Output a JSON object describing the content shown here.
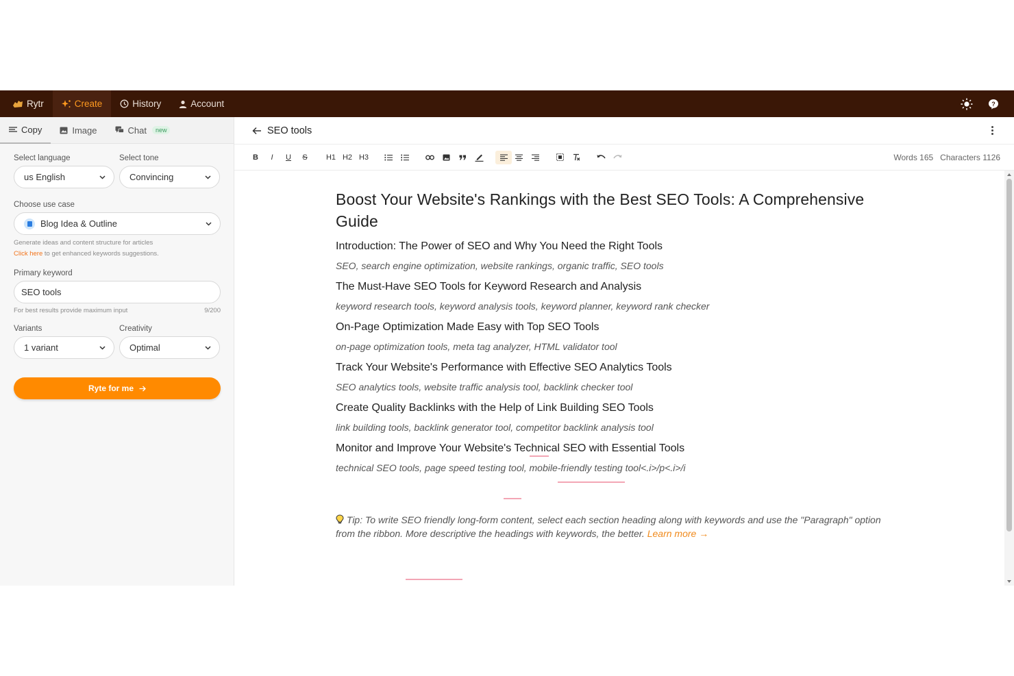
{
  "nav": {
    "logo": "Rytr",
    "items": [
      {
        "label": "Create",
        "icon": "sparkle-icon",
        "active": true
      },
      {
        "label": "History",
        "icon": "clock-icon"
      },
      {
        "label": "Account",
        "icon": "user-icon"
      }
    ],
    "right_icons": [
      "sun-icon",
      "help-icon"
    ]
  },
  "sidebar": {
    "tabs": [
      {
        "label": "Copy",
        "icon": "lines-icon",
        "active": true
      },
      {
        "label": "Image",
        "icon": "image-icon"
      },
      {
        "label": "Chat",
        "icon": "chat-icon",
        "badge": "new"
      }
    ],
    "language": {
      "label": "Select language",
      "value": "us English"
    },
    "tone": {
      "label": "Select tone",
      "value": "Convincing"
    },
    "use_case": {
      "label": "Choose use case",
      "value": "Blog Idea & Outline",
      "desc": "Generate ideas and content structure for articles",
      "link": "Click here",
      "link_suffix": "to get enhanced keywords suggestions."
    },
    "keyword": {
      "label": "Primary keyword",
      "value": "SEO tools",
      "hint": "For best results provide maximum input",
      "count": "9/200"
    },
    "variants": {
      "label": "Variants",
      "value": "1 variant"
    },
    "creativity": {
      "label": "Creativity",
      "value": "Optimal"
    },
    "ryte_button": "Ryte for me"
  },
  "editor": {
    "doc_title": "SEO tools",
    "toolbar": {
      "bold": "B",
      "italic": "I",
      "underline": "U",
      "strike": "S",
      "h1": "H1",
      "h2": "H2",
      "h3": "H3"
    },
    "words_label": "Words 165",
    "chars_label": "Characters 1126",
    "title": "Boost Your Website's Rankings with the Best SEO Tools: A Comprehensive Guide",
    "sections": [
      {
        "heading": "Introduction: The Power of SEO and Why You Need the Right Tools",
        "keywords": "SEO, search engine optimization, website rankings, organic traffic, SEO tools"
      },
      {
        "heading": "The Must-Have SEO Tools for Keyword Research and Analysis",
        "keywords": "keyword research tools, keyword analysis tools, keyword planner, keyword rank checker"
      },
      {
        "heading": "On-Page Optimization Made Easy with Top SEO Tools",
        "keywords": "on-page optimization tools, meta tag analyzer, HTML validator tool"
      },
      {
        "heading": "Track Your Website's Performance with Effective SEO Analytics Tools",
        "keywords": "SEO analytics tools, website traffic analysis tool, backlink checker tool"
      },
      {
        "heading": "Create Quality Backlinks with the Help of Link Building SEO Tools",
        "keywords": "link building tools, backlink generator tool, competitor backlink analysis tool"
      },
      {
        "heading": "Monitor and Improve Your Website's Technical SEO with Essential Tools",
        "keywords": "technical SEO tools, page speed testing tool, mobile-friendly testing tool<.i>/p<.i>/i"
      }
    ],
    "tip": "Tip: To write SEO friendly long-form content, select each section heading along with keywords and use the \"Paragraph\" option from the ribbon. More descriptive the headings with keywords, the better.",
    "tip_link": "Learn more →"
  },
  "colors": {
    "nav_bg": "#3a1706",
    "accent": "#ff8a00",
    "link": "#f2731a"
  }
}
